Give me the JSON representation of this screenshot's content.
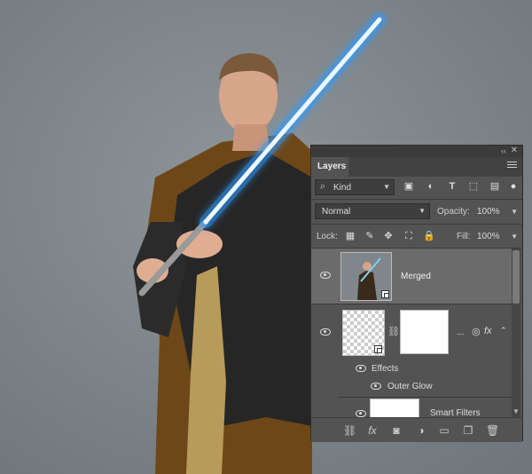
{
  "panel": {
    "title": "Layers",
    "collapse_glyph": "‹‹",
    "close_glyph": "✕",
    "filter": {
      "kind_label": "Kind",
      "icons": [
        "image-filter-icon",
        "adjustment-filter-icon",
        "type-filter-icon",
        "shape-filter-icon",
        "smart-object-filter-icon"
      ]
    },
    "blend_mode": "Normal",
    "opacity_label": "Opacity:",
    "opacity_value": "100%",
    "lock_label": "Lock:",
    "fill_label": "Fill:",
    "fill_value": "100%",
    "layers": [
      {
        "name": "Merged",
        "visible": true,
        "selected": true
      },
      {
        "name": "",
        "visible": true,
        "ellipsis": "...",
        "fx": "fx",
        "chain": "link-icon"
      }
    ],
    "effects_label": "Effects",
    "outer_glow_label": "Outer Glow",
    "smart_filters_label": "Smart Filters",
    "bottom_icons": [
      "link-layers-icon",
      "fx-icon",
      "mask-icon",
      "adjustment-layer-icon",
      "group-folder-icon",
      "new-layer-icon",
      "trash-icon"
    ],
    "fx_text": "fx"
  },
  "colors": {
    "panel_bg": "#535353",
    "selected_layer": "#6b6b6b",
    "saber_glow": "#3aa9ff"
  }
}
